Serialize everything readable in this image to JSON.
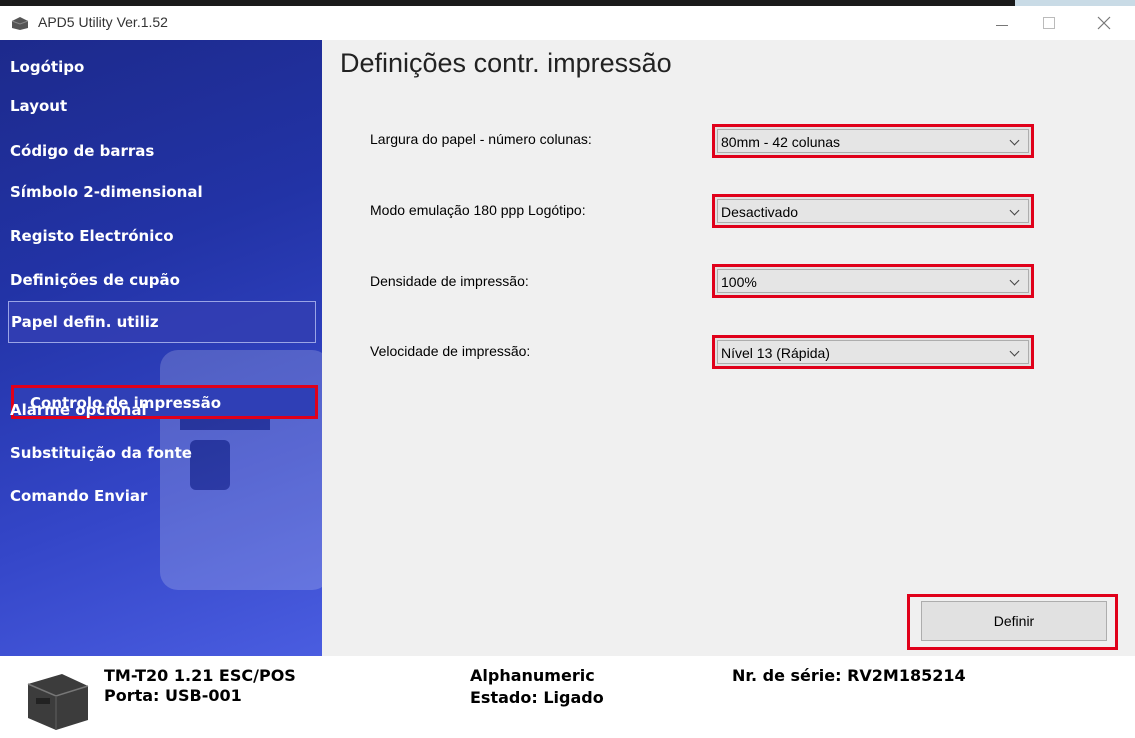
{
  "window": {
    "title": "APD5 Utility Ver.1.52"
  },
  "sidebar": {
    "items": [
      {
        "label": "Logótipo"
      },
      {
        "label": "Layout"
      },
      {
        "label": "Código de barras"
      },
      {
        "label": "Símbolo 2-dimensional"
      },
      {
        "label": "Registo Electrónico"
      },
      {
        "label": "Definições de cupão"
      },
      {
        "label": "Papel defin. utiliz"
      },
      {
        "label": "Controlo de impressão",
        "active": true
      },
      {
        "label": "Alarme opcional"
      },
      {
        "label": "Substituição da fonte"
      },
      {
        "label": "Comando Enviar"
      }
    ]
  },
  "main": {
    "title": "Definições contr. impressão",
    "fields": [
      {
        "label": "Largura do papel - número colunas:",
        "value": "80mm - 42 colunas"
      },
      {
        "label": "Modo emulação 180 ppp Logótipo:",
        "value": "Desactivado"
      },
      {
        "label": "Densidade de impressão:",
        "value": "100%"
      },
      {
        "label": "Velocidade de impressão:",
        "value": "Nível 13 (Rápida)"
      }
    ],
    "define_button": "Definir"
  },
  "footer": {
    "model": "TM-T20 1.21 ESC/POS",
    "port": "Porta: USB-001",
    "mode": "Alphanumeric",
    "status": "Estado: Ligado",
    "serial": "Nr. de série: RV2M185214"
  },
  "colors": {
    "highlight": "#e0001a",
    "sidebar": "#2233a6"
  }
}
